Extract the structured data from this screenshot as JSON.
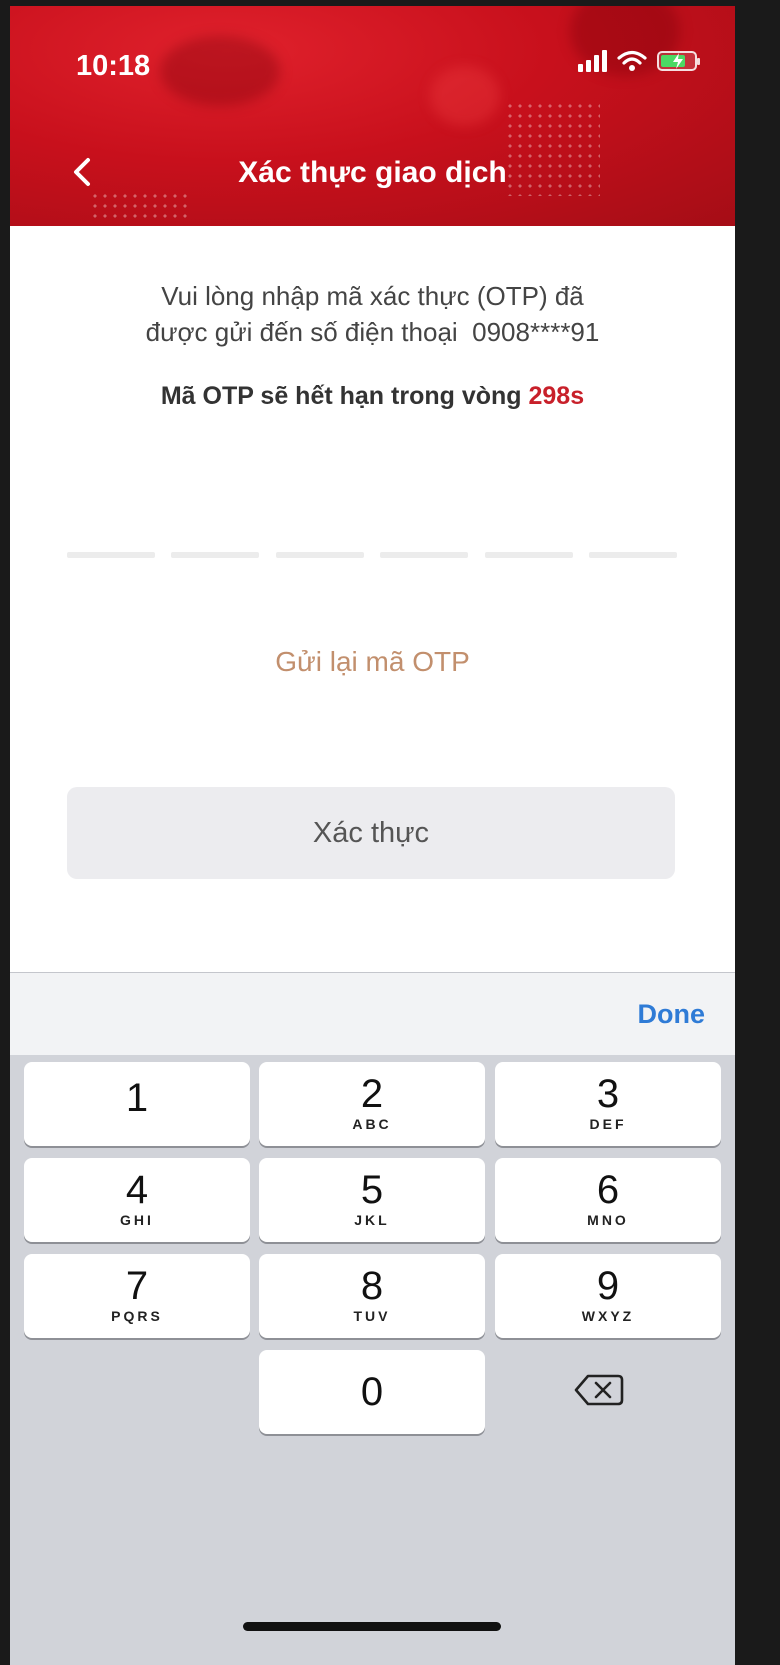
{
  "status_bar": {
    "time": "10:18",
    "icons": [
      "signal-icon",
      "wifi-icon",
      "battery-charging-icon"
    ]
  },
  "header": {
    "title": "Xác thực giao dịch",
    "back_icon": "chevron-left-icon",
    "color": "#cd1520"
  },
  "content": {
    "instruction_line1": "Vui lòng nhập mã xác thực (OTP) đã",
    "instruction_line2": "được gửi đến số điện thoại  0908****91",
    "expiry_label": "Mã OTP sẽ hết hạn trong vòng ",
    "expiry_countdown": "298s",
    "otp_length": 6,
    "resend_label": "Gửi lại mã OTP",
    "verify_label": "Xác thực"
  },
  "keyboard": {
    "done_label": "Done",
    "keys": [
      {
        "digit": "1",
        "letters": ""
      },
      {
        "digit": "2",
        "letters": "ABC"
      },
      {
        "digit": "3",
        "letters": "DEF"
      },
      {
        "digit": "4",
        "letters": "GHI"
      },
      {
        "digit": "5",
        "letters": "JKL"
      },
      {
        "digit": "6",
        "letters": "MNO"
      },
      {
        "digit": "7",
        "letters": "PQRS"
      },
      {
        "digit": "8",
        "letters": "TUV"
      },
      {
        "digit": "9",
        "letters": "WXYZ"
      },
      {
        "digit": "0",
        "letters": ""
      }
    ],
    "backspace_icon": "backspace-icon"
  },
  "colors": {
    "accent": "#cd1520",
    "countdown": "#c8202a",
    "resend": "#c28f6d",
    "done": "#2f7bd6"
  }
}
